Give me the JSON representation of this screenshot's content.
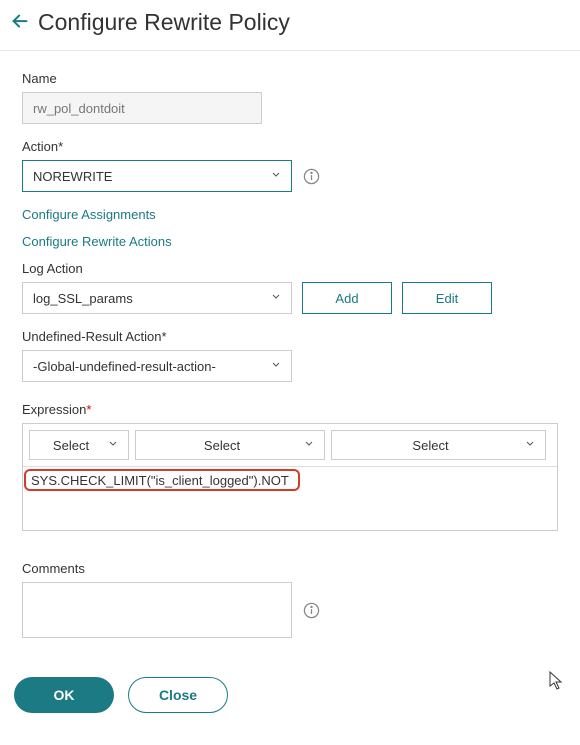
{
  "header": {
    "title": "Configure Rewrite Policy"
  },
  "name": {
    "label": "Name",
    "value": "rw_pol_dontdoit"
  },
  "action": {
    "label": "Action*",
    "value": "NOREWRITE"
  },
  "links": {
    "assignments": "Configure Assignments",
    "rewrite_actions": "Configure Rewrite Actions"
  },
  "log_action": {
    "label": "Log Action",
    "value": "log_SSL_params",
    "add_btn": "Add",
    "edit_btn": "Edit"
  },
  "undef_action": {
    "label": "Undefined-Result Action*",
    "value": "-Global-undefined-result-action-"
  },
  "expression": {
    "label": "Expression",
    "sel1": "Select",
    "sel2": "Select",
    "sel3": "Select",
    "value": "SYS.CHECK_LIMIT(\"is_client_logged\").NOT"
  },
  "comments": {
    "label": "Comments",
    "value": ""
  },
  "footer": {
    "ok": "OK",
    "close": "Close"
  }
}
